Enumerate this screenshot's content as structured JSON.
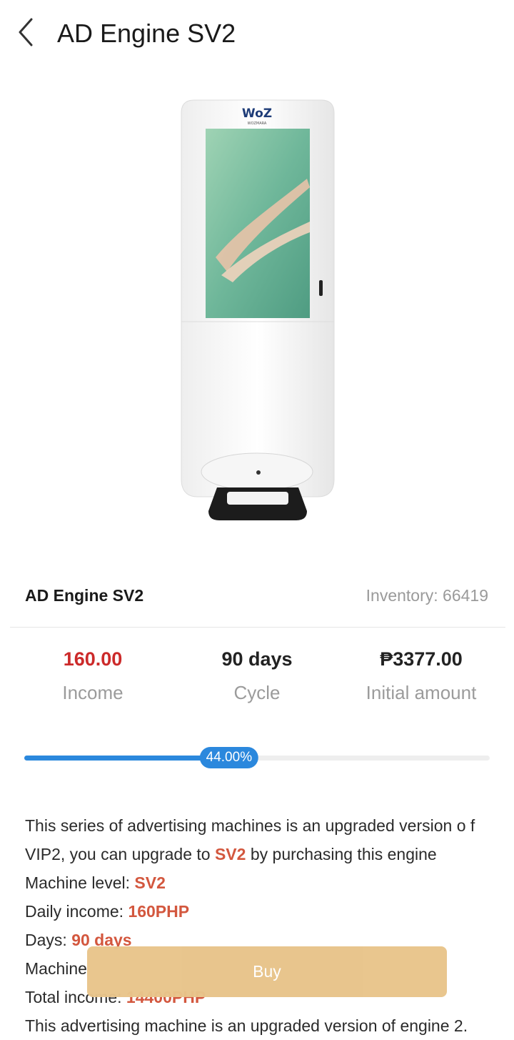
{
  "header": {
    "back_icon": "chevron-left-icon",
    "title": "AD Engine SV2"
  },
  "product": {
    "name": "AD Engine SV2",
    "inventory": "Inventory: 66419",
    "image_logo_text": "WoZ",
    "image_logo_subtext": "WOZMARA"
  },
  "stats": [
    {
      "value": "160.00",
      "label": "Income",
      "color": "#cc2a2a"
    },
    {
      "value": "90 days",
      "label": "Cycle"
    },
    {
      "value": "₱3377.00",
      "label": "Initial amount"
    }
  ],
  "progress": {
    "percent": 44.0,
    "label": "44.00%"
  },
  "description": {
    "intro_pre": "This series of advertising machines is an upgraded version o f VIP2, you can upgrade to ",
    "intro_highlight": "SV2",
    "intro_post": " by purchasing this engine",
    "machine_level_label": "Machine level: ",
    "machine_level_value": "SV2",
    "daily_income_label": "Daily income: ",
    "daily_income_value": "160PHP",
    "days_label": "Days: ",
    "days_value": "90 days",
    "machine_line_label": "Machine",
    "total_income_label": "Total income: ",
    "total_income_value": "14400PHP",
    "outro": "This advertising machine is an upgraded version of engine 2."
  },
  "buy_button": {
    "label": "Buy"
  },
  "colors": {
    "accent_blue": "#2b88dd",
    "income_red": "#cc2a2a",
    "highlight": "#d3573e",
    "buy_button": "#e8c48a"
  }
}
